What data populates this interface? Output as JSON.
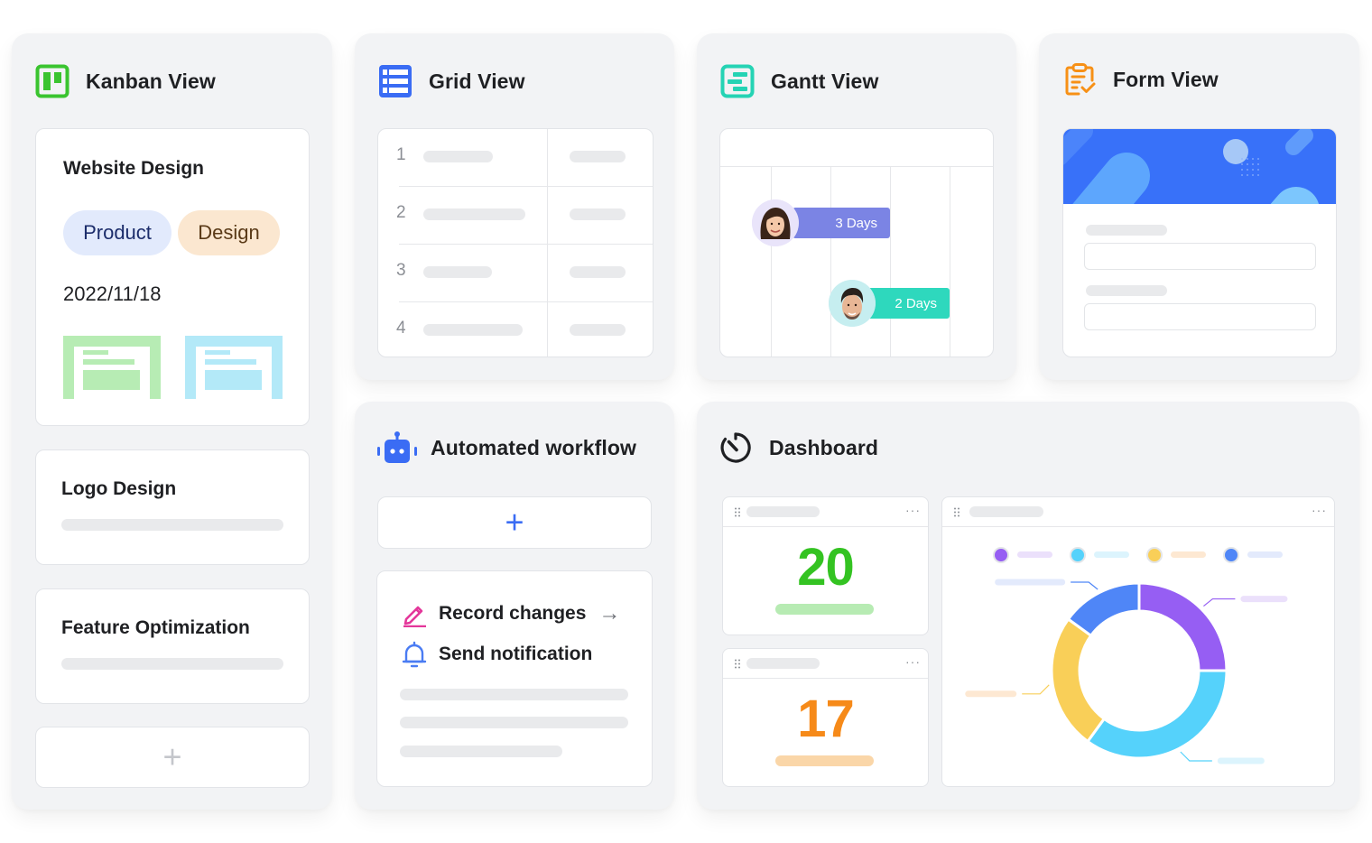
{
  "kanban": {
    "title": "Kanban View",
    "icon": "kanban-board-icon",
    "accent": "#3ac42f",
    "cards": [
      {
        "title": "Website Design",
        "tags": [
          {
            "label": "Product",
            "bg": "#e2eafc",
            "fg": "#1c2d6b"
          },
          {
            "label": "Design",
            "bg": "#fbe7d0",
            "fg": "#5a3a17"
          }
        ],
        "date": "2022/11/18",
        "thumbnails": [
          {
            "color": "#b7ecb4"
          },
          {
            "color": "#b3e9f8"
          }
        ]
      },
      {
        "title": "Logo Design"
      },
      {
        "title": "Feature Optimization"
      }
    ],
    "add_label": "+"
  },
  "grid": {
    "title": "Grid View",
    "icon": "table-grid-icon",
    "accent": "#3a6cf4",
    "rows": [
      {
        "num": "1"
      },
      {
        "num": "2"
      },
      {
        "num": "3"
      },
      {
        "num": "4"
      }
    ]
  },
  "gantt": {
    "title": "Gantt View",
    "icon": "gantt-chart-icon",
    "accent": "#25d3b4",
    "tasks": [
      {
        "label": "3 Days",
        "color": "#7b84e4",
        "avatar": "woman-avatar"
      },
      {
        "label": "2 Days",
        "color": "#2ed8bd",
        "avatar": "man-avatar"
      }
    ]
  },
  "form": {
    "title": "Form View",
    "icon": "clipboard-check-icon",
    "accent": "#f79016",
    "banner_color": "#3871f9"
  },
  "workflow": {
    "title": "Automated workflow",
    "icon": "robot-icon",
    "accent": "#3a6cf4",
    "add_label": "+",
    "steps": [
      {
        "label": "Record changes",
        "icon": "pencil-edit-icon",
        "color": "#e4379a",
        "arrow": "→"
      },
      {
        "label": "Send notification",
        "icon": "bell-icon",
        "color": "#4a7cf3"
      }
    ]
  },
  "dashboard": {
    "title": "Dashboard",
    "icon": "stopwatch-icon",
    "more_label": "···",
    "stats": [
      {
        "value": "20",
        "color": "#34c322",
        "bar_color": "#b7ebb3"
      },
      {
        "value": "17",
        "color": "#f68a19",
        "bar_color": "#fad6a8"
      }
    ],
    "donut": {
      "slices": [
        {
          "name": "purple",
          "percent": 25,
          "color": "#965ef3",
          "label_color": "#ebe0fb"
        },
        {
          "name": "cyan",
          "percent": 35,
          "color": "#55d2fb",
          "label_color": "#dcf4fd"
        },
        {
          "name": "yellow",
          "percent": 25,
          "color": "#f9cf58",
          "label_color": "#fde8d2"
        },
        {
          "name": "blue",
          "percent": 15,
          "color": "#4f86f7",
          "label_color": "#e3eafc"
        }
      ]
    }
  }
}
